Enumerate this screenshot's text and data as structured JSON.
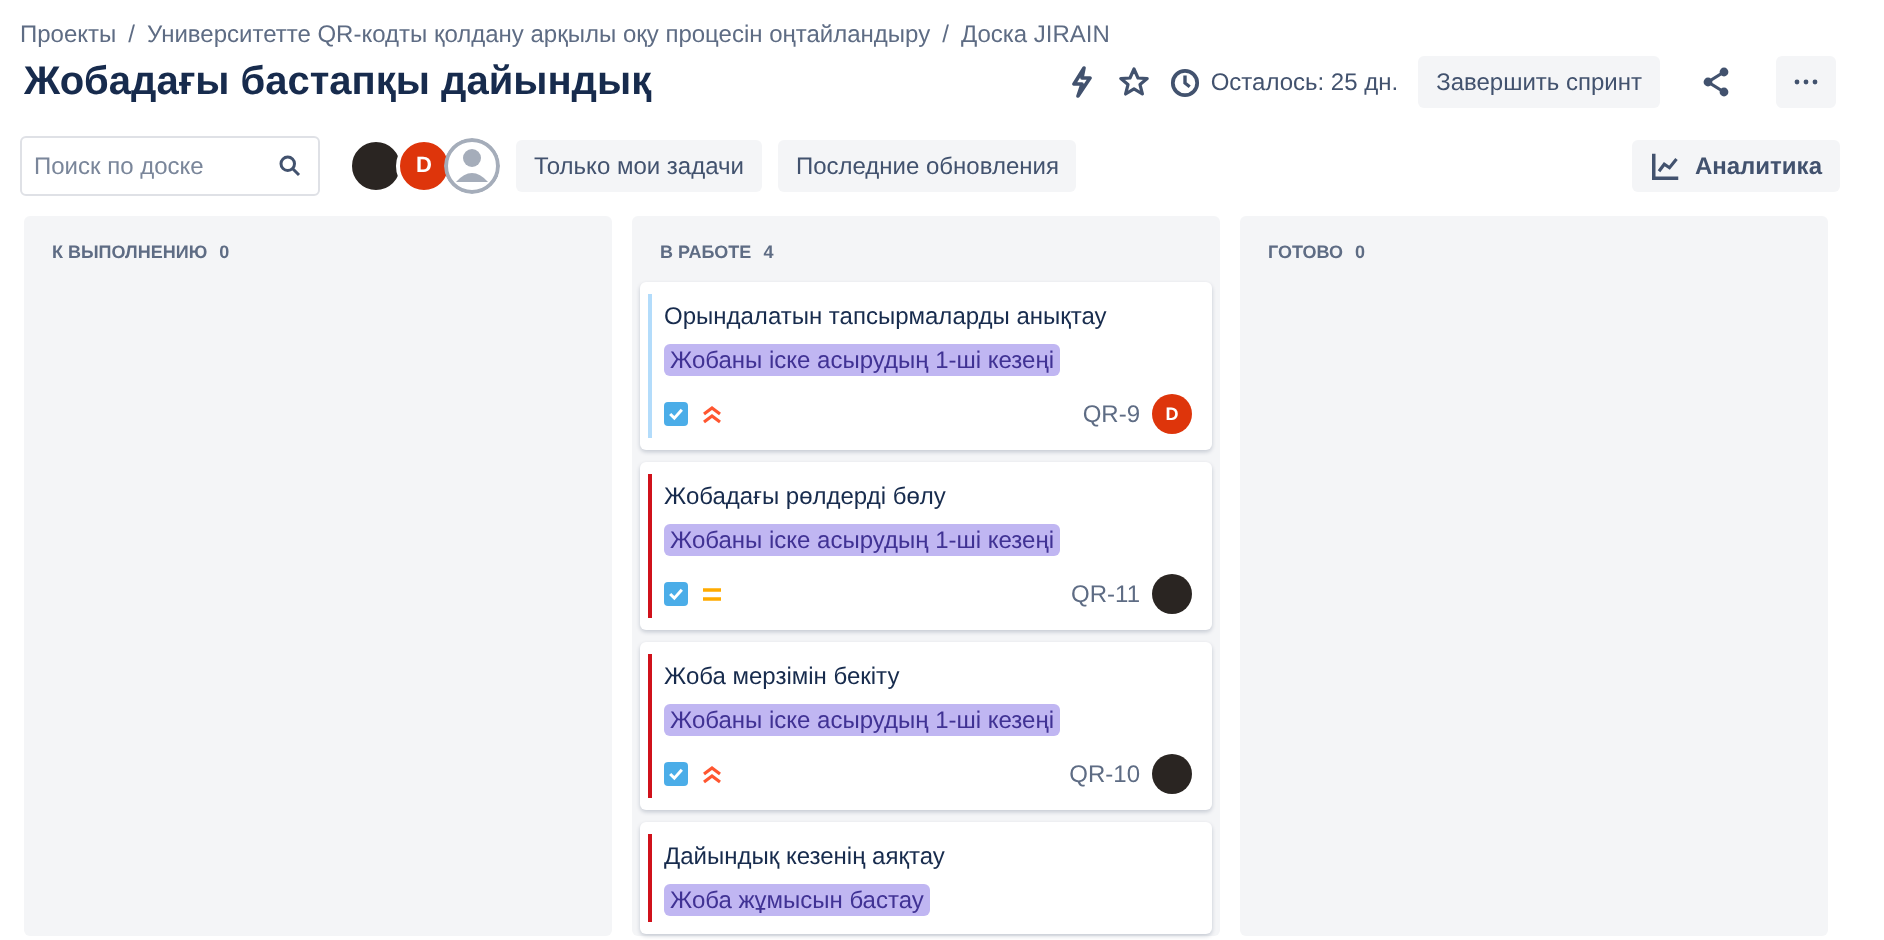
{
  "breadcrumbs": {
    "separator": "/",
    "items": [
      "Проекты",
      "Университетте QR-кодты қолдану арқылы оқу процесін оңтайландыру",
      "Доска JIRAIN"
    ]
  },
  "title": "Жобадағы бастапқы дайындық",
  "header_actions": {
    "remaining": "Осталось: 25 дн.",
    "complete_button": "Завершить спринт"
  },
  "toolbar": {
    "search": {
      "placeholder": "Поиск по доске"
    },
    "avatars": [
      {
        "kind": "photo"
      },
      {
        "kind": "letter",
        "letter": "D"
      },
      {
        "kind": "generic"
      }
    ],
    "filters": [
      "Только мои задачи",
      "Последние обновления"
    ],
    "analytics_button": "Аналитика"
  },
  "columns": [
    {
      "title": "К ВЫПОЛНЕНИЮ",
      "count": "0"
    },
    {
      "title": "В РАБОТЕ",
      "count": "4",
      "cards": [
        {
          "title": "Орындалатын тапсырмаларды анықтау",
          "epic": "Жобаны іске асырудың 1-ші кезеңі",
          "done": true,
          "priority": {
            "kind": "high"
          },
          "key": "QR-9",
          "assignee": {
            "kind": "letter",
            "letter": "D"
          },
          "color": "#b3dcfb"
        },
        {
          "title": "Жобадағы рөлдерді бөлу",
          "epic": "Жобаны іске асырудың 1-ші кезеңі",
          "done": true,
          "priority": {
            "kind": "medium"
          },
          "key": "QR-11",
          "assignee": {
            "kind": "photo"
          },
          "color": "#d0111b"
        },
        {
          "title": "Жоба мерзімін бекіту",
          "epic": "Жобаны іске асырудың 1-ші кезеңі",
          "done": true,
          "priority": {
            "kind": "high"
          },
          "key": "QR-10",
          "assignee": {
            "kind": "photo"
          },
          "color": "#d0111b"
        },
        {
          "title": "Дайындық кезенің аяқтау",
          "epic": "Жоба жұмысын бастау",
          "color": "#d0111b"
        }
      ]
    },
    {
      "title": "ГОТОВО",
      "count": "0"
    }
  ]
}
